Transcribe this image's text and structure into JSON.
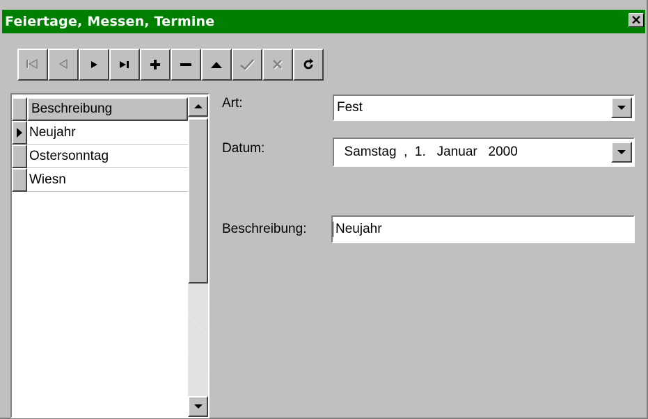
{
  "window": {
    "title": "Feiertage, Messen, Termine",
    "close_glyph": "✕"
  },
  "navigator": {
    "buttons": [
      {
        "name": "first-record-button",
        "icon": "first-icon",
        "enabled": false
      },
      {
        "name": "prior-record-button",
        "icon": "prior-icon",
        "enabled": false
      },
      {
        "name": "next-record-button",
        "icon": "next-icon",
        "enabled": true
      },
      {
        "name": "last-record-button",
        "icon": "last-icon",
        "enabled": true
      },
      {
        "name": "insert-record-button",
        "icon": "plus-icon",
        "enabled": true
      },
      {
        "name": "delete-record-button",
        "icon": "minus-icon",
        "enabled": true
      },
      {
        "name": "edit-record-button",
        "icon": "up-triangle-icon",
        "enabled": true
      },
      {
        "name": "post-record-button",
        "icon": "check-icon",
        "enabled": false
      },
      {
        "name": "cancel-record-button",
        "icon": "cross-icon",
        "enabled": false
      },
      {
        "name": "refresh-button",
        "icon": "refresh-icon",
        "enabled": true
      }
    ]
  },
  "grid": {
    "column_header": "Beschreibung",
    "rows": [
      {
        "value": "Neujahr",
        "current": true
      },
      {
        "value": "Ostersonntag",
        "current": false
      },
      {
        "value": "Wiesn",
        "current": false
      }
    ]
  },
  "form": {
    "art_label": "Art:",
    "art_value": "Fest",
    "datum_label": "Datum:",
    "datum_value": "  Samstag  ,  1.   Januar   2000",
    "beschreibung_label": "Beschreibung:",
    "beschreibung_value": "Neujahr"
  },
  "colors": {
    "titlebar": "#008000",
    "face": "#c0c0c0",
    "disabled": "#808080"
  }
}
